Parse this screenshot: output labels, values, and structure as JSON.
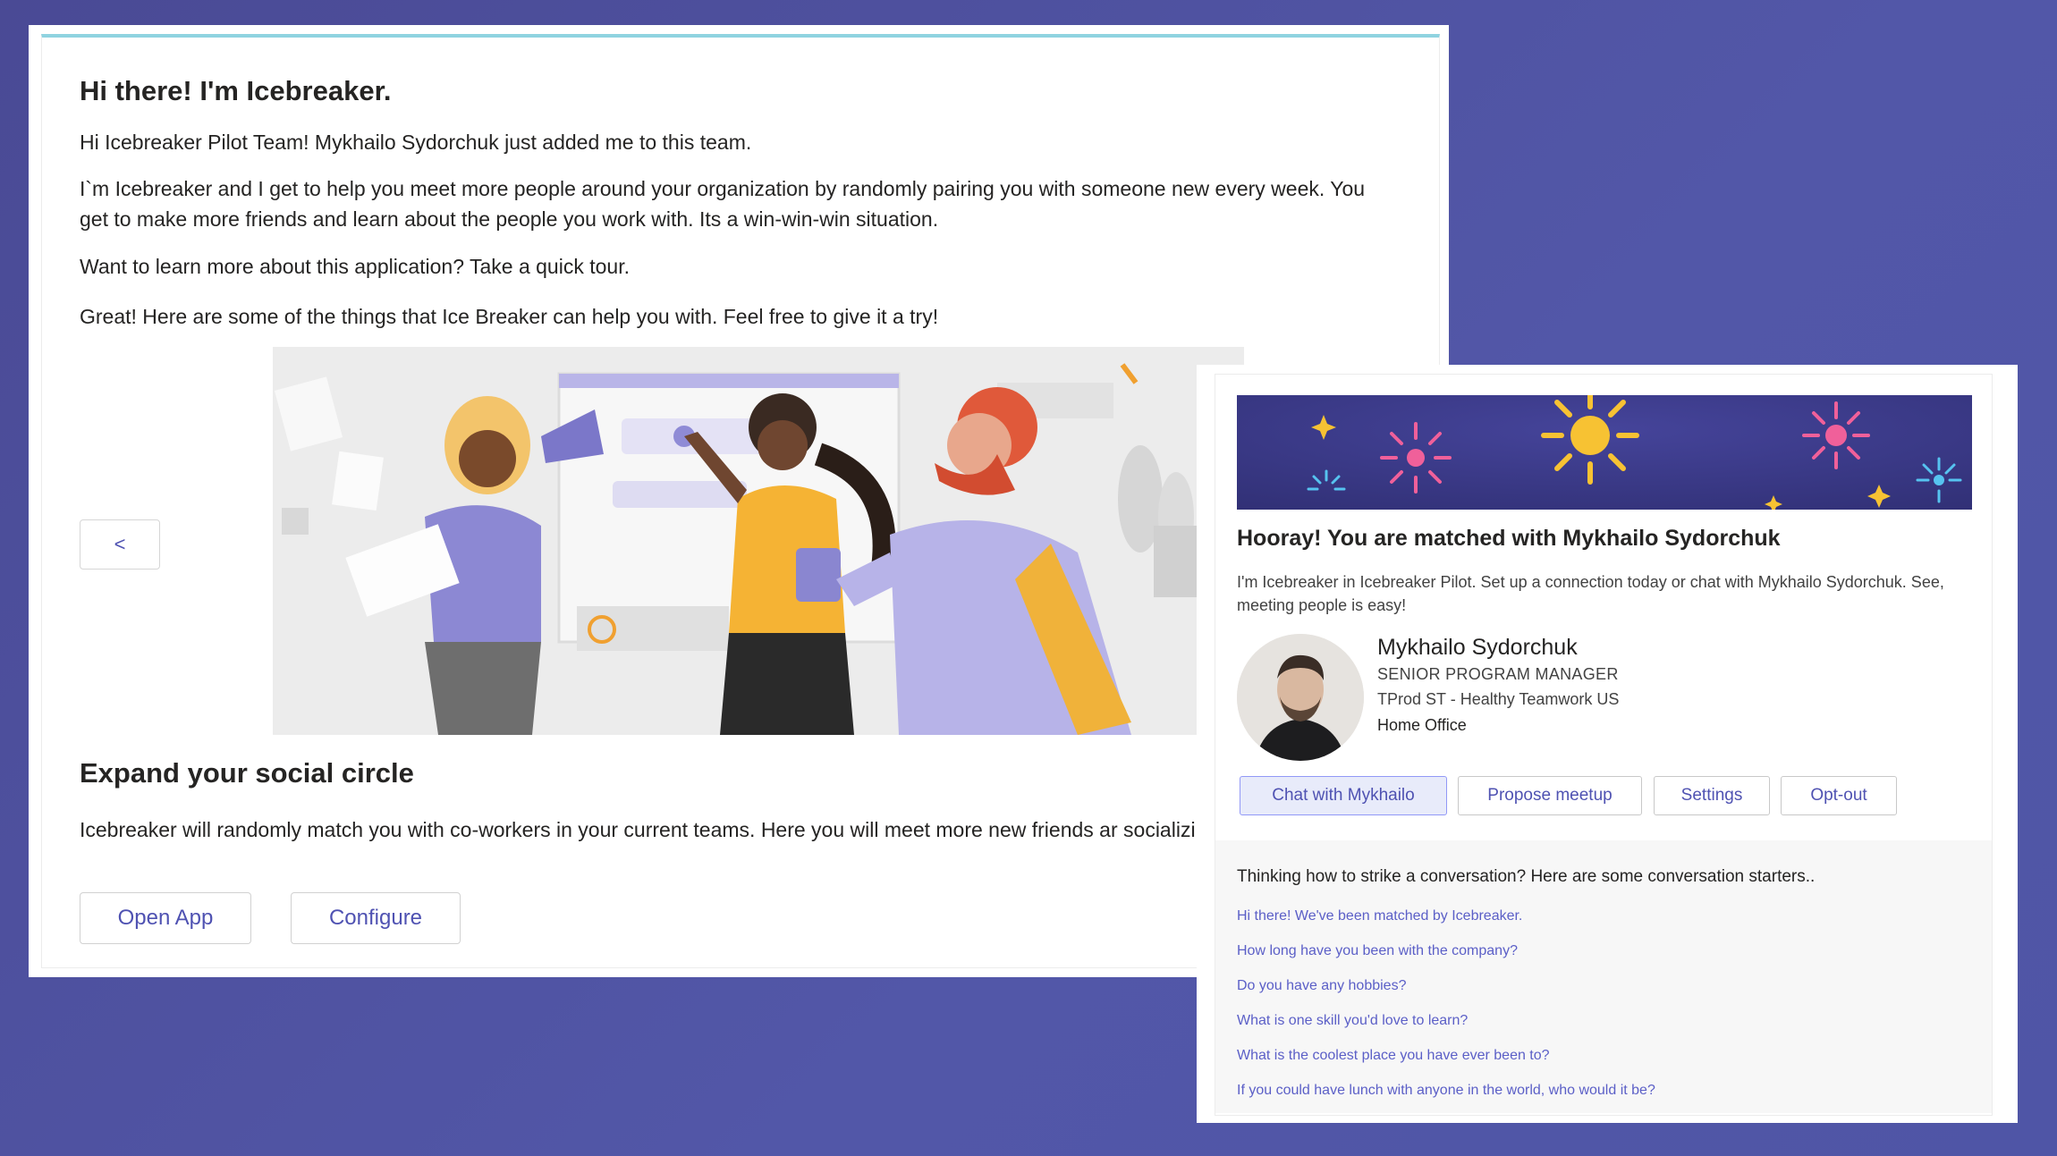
{
  "welcome": {
    "title": "Hi there! I'm Icebreaker.",
    "p1": "Hi Icebreaker Pilot Team! Mykhailo Sydorchuk just added me to this team.",
    "p2": "I`m Icebreaker and I get to help you meet more people around your organization by randomly pairing you with someone new every week. You get to make more friends and learn about the people you work with. Its a win-win-win situation.",
    "p3": "Want to learn more about this application? Take a quick tour.",
    "p4": "Great! Here are some of the things that Ice Breaker can help you with. Feel free to give it a try!",
    "prev_label": "<",
    "section_title": "Expand your social circle",
    "section_body": "Icebreaker will randomly match you with co-workers in your current teams. Here you will meet more new friends ar socializing!",
    "open_app_label": "Open App",
    "configure_label": "Configure"
  },
  "match": {
    "title": "Hooray! You are matched with Mykhailo Sydorchuk",
    "description": "I'm Icebreaker in Icebreaker Pilot. Set up a connection today or chat with Mykhailo Sydorchuk. See, meeting people is easy!",
    "person": {
      "name": "Mykhailo Sydorchuk",
      "title": "SENIOR PROGRAM MANAGER",
      "team": "TProd ST - Healthy Teamwork US",
      "location": "Home Office"
    },
    "buttons": {
      "chat": "Chat with Mykhailo",
      "propose": "Propose meetup",
      "settings": "Settings",
      "optout": "Opt-out"
    },
    "starters_title": "Thinking how to strike a conversation? Here are some conversation starters..",
    "starters": [
      "Hi there! We've been matched by Icebreaker.",
      "How long have you been with the company?",
      "Do you have any hobbies?",
      "What is one skill you'd love to learn?",
      "What is the coolest place you have ever been to?",
      "If you could have lunch with anyone in the world, who would it be?"
    ]
  },
  "colors": {
    "background": "#4f55a6",
    "accent": "#4f52b2",
    "link": "#5b5fc7",
    "card_top_border": "#8fd3e0",
    "banner": "#3b3a8c"
  }
}
